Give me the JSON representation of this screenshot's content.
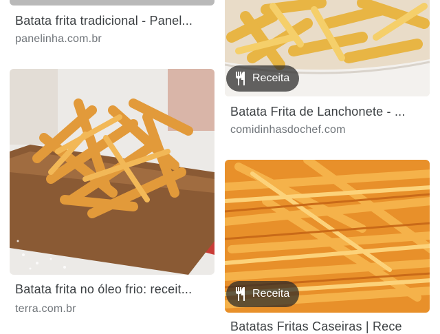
{
  "results": [
    {
      "title": "Batata frita tradicional - Panel...",
      "source": "panelinha.com.br"
    },
    {
      "title": "Batata Frita de Lanchonete - ...",
      "source": "comidinhasdochef.com",
      "badge": "Receita"
    },
    {
      "title": "Batata frita no óleo frio: receit...",
      "source": "terra.com.br"
    },
    {
      "title": "Batatas Fritas Caseiras | Rece",
      "source": "",
      "badge": "Receita"
    }
  ],
  "icons": {
    "badge_icon": "fork-knife-icon"
  },
  "colors": {
    "title": "#3c4043",
    "source": "#70757a",
    "badge_bg": "#2f2f2f"
  }
}
